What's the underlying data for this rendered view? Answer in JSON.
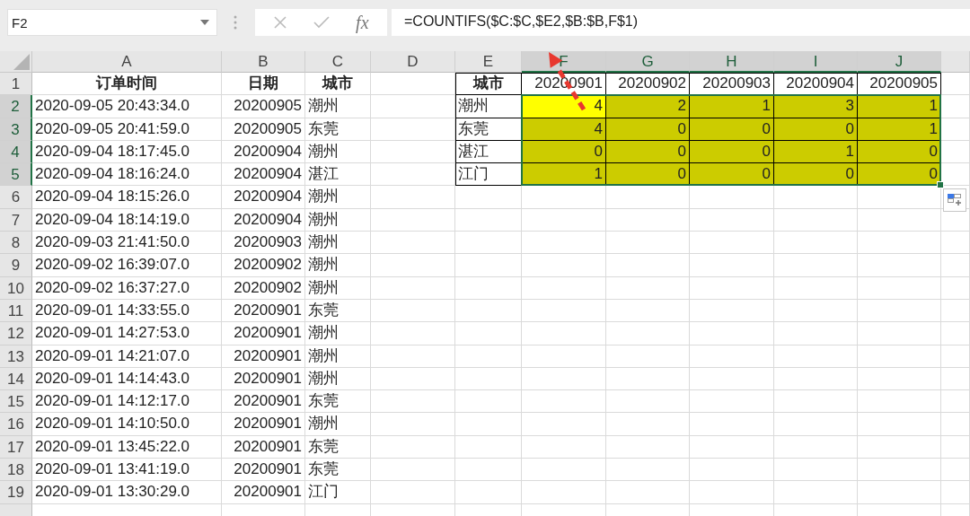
{
  "name_box": {
    "value": "F2"
  },
  "formula_bar": {
    "function_label": "fx",
    "value": "=COUNTIFS($C:$C,$E2,$B:$B,F$1)"
  },
  "column_headers": [
    {
      "label": "A",
      "selected": false
    },
    {
      "label": "B",
      "selected": false
    },
    {
      "label": "C",
      "selected": false
    },
    {
      "label": "D",
      "selected": false
    },
    {
      "label": "E",
      "selected": false
    },
    {
      "label": "F",
      "selected": true
    },
    {
      "label": "G",
      "selected": true
    },
    {
      "label": "H",
      "selected": true
    },
    {
      "label": "I",
      "selected": true
    },
    {
      "label": "J",
      "selected": true
    }
  ],
  "rows": [
    {
      "number": "1",
      "selected": false,
      "orders": {
        "order_time": "订单时间",
        "date": "日期",
        "city": "城市"
      },
      "summary": {
        "city": "城市",
        "values": [
          {
            "value": "20200901",
            "selected": false,
            "active": false
          },
          {
            "value": "20200902",
            "selected": false,
            "active": false
          },
          {
            "value": "20200903",
            "selected": false,
            "active": false
          },
          {
            "value": "20200904",
            "selected": false,
            "active": false
          },
          {
            "value": "20200905",
            "selected": false,
            "active": false
          }
        ]
      }
    },
    {
      "number": "2",
      "selected": true,
      "orders": {
        "order_time": "2020-09-05 20:43:34.0",
        "date": "20200905",
        "city": "潮州"
      },
      "summary": {
        "city": "潮州",
        "values": [
          {
            "value": "4",
            "selected": true,
            "active": true
          },
          {
            "value": "2",
            "selected": true,
            "active": false
          },
          {
            "value": "1",
            "selected": true,
            "active": false
          },
          {
            "value": "3",
            "selected": true,
            "active": false
          },
          {
            "value": "1",
            "selected": true,
            "active": false
          }
        ]
      }
    },
    {
      "number": "3",
      "selected": true,
      "orders": {
        "order_time": "2020-09-05 20:41:59.0",
        "date": "20200905",
        "city": "东莞"
      },
      "summary": {
        "city": "东莞",
        "values": [
          {
            "value": "4",
            "selected": true,
            "active": false
          },
          {
            "value": "0",
            "selected": true,
            "active": false
          },
          {
            "value": "0",
            "selected": true,
            "active": false
          },
          {
            "value": "0",
            "selected": true,
            "active": false
          },
          {
            "value": "1",
            "selected": true,
            "active": false
          }
        ]
      }
    },
    {
      "number": "4",
      "selected": true,
      "orders": {
        "order_time": "2020-09-04 18:17:45.0",
        "date": "20200904",
        "city": "潮州"
      },
      "summary": {
        "city": "湛江",
        "values": [
          {
            "value": "0",
            "selected": true,
            "active": false
          },
          {
            "value": "0",
            "selected": true,
            "active": false
          },
          {
            "value": "0",
            "selected": true,
            "active": false
          },
          {
            "value": "1",
            "selected": true,
            "active": false
          },
          {
            "value": "0",
            "selected": true,
            "active": false
          }
        ]
      }
    },
    {
      "number": "5",
      "selected": true,
      "orders": {
        "order_time": "2020-09-04 18:16:24.0",
        "date": "20200904",
        "city": "湛江"
      },
      "summary": {
        "city": "江门",
        "values": [
          {
            "value": "1",
            "selected": true,
            "active": false
          },
          {
            "value": "0",
            "selected": true,
            "active": false
          },
          {
            "value": "0",
            "selected": true,
            "active": false
          },
          {
            "value": "0",
            "selected": true,
            "active": false
          },
          {
            "value": "0",
            "selected": true,
            "active": false
          }
        ]
      }
    },
    {
      "number": "6",
      "selected": false,
      "orders": {
        "order_time": "2020-09-04 18:15:26.0",
        "date": "20200904",
        "city": "潮州"
      }
    },
    {
      "number": "7",
      "selected": false,
      "orders": {
        "order_time": "2020-09-04 18:14:19.0",
        "date": "20200904",
        "city": "潮州"
      }
    },
    {
      "number": "8",
      "selected": false,
      "orders": {
        "order_time": "2020-09-03 21:41:50.0",
        "date": "20200903",
        "city": "潮州"
      }
    },
    {
      "number": "9",
      "selected": false,
      "orders": {
        "order_time": "2020-09-02 16:39:07.0",
        "date": "20200902",
        "city": "潮州"
      }
    },
    {
      "number": "10",
      "selected": false,
      "orders": {
        "order_time": "2020-09-02 16:37:27.0",
        "date": "20200902",
        "city": "潮州"
      }
    },
    {
      "number": "11",
      "selected": false,
      "orders": {
        "order_time": "2020-09-01 14:33:55.0",
        "date": "20200901",
        "city": "东莞"
      }
    },
    {
      "number": "12",
      "selected": false,
      "orders": {
        "order_time": "2020-09-01 14:27:53.0",
        "date": "20200901",
        "city": "潮州"
      }
    },
    {
      "number": "13",
      "selected": false,
      "orders": {
        "order_time": "2020-09-01 14:21:07.0",
        "date": "20200901",
        "city": "潮州"
      }
    },
    {
      "number": "14",
      "selected": false,
      "orders": {
        "order_time": "2020-09-01 14:14:43.0",
        "date": "20200901",
        "city": "潮州"
      }
    },
    {
      "number": "15",
      "selected": false,
      "orders": {
        "order_time": "2020-09-01 14:12:17.0",
        "date": "20200901",
        "city": "东莞"
      }
    },
    {
      "number": "16",
      "selected": false,
      "orders": {
        "order_time": "2020-09-01 14:10:50.0",
        "date": "20200901",
        "city": "潮州"
      }
    },
    {
      "number": "17",
      "selected": false,
      "orders": {
        "order_time": "2020-09-01 13:45:22.0",
        "date": "20200901",
        "city": "东莞"
      }
    },
    {
      "number": "18",
      "selected": false,
      "orders": {
        "order_time": "2020-09-01 13:41:19.0",
        "date": "20200901",
        "city": "东莞"
      }
    },
    {
      "number": "19",
      "selected": false,
      "orders": {
        "order_time": "2020-09-01 13:30:29.0",
        "date": "20200901",
        "city": "江门"
      }
    }
  ]
}
